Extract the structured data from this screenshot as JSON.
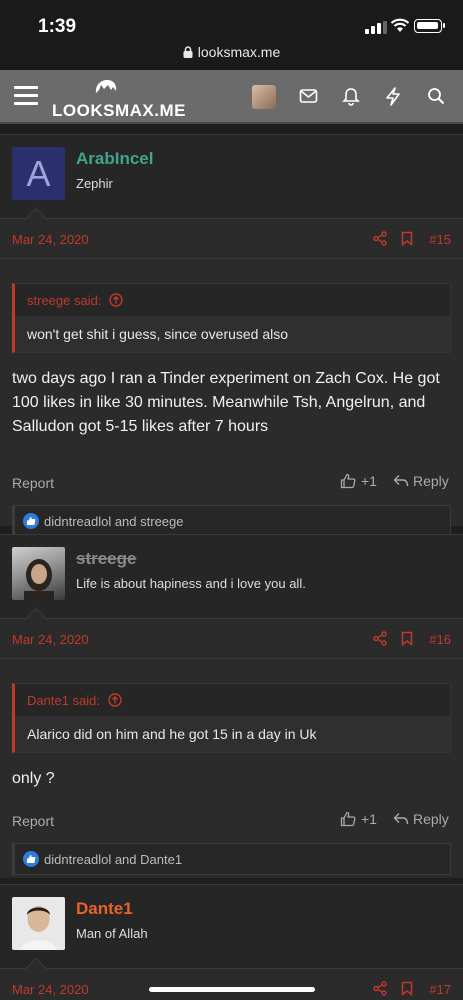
{
  "status": {
    "time": "1:39"
  },
  "browser": {
    "url": "looksmax.me"
  },
  "header": {
    "logo_text": "LOOKSMAX.ME"
  },
  "posts": [
    {
      "username": "ArabIncel",
      "username_color": "#3fa58c",
      "user_title": "Zephir",
      "avatar_letter": "A",
      "date": "Mar 24, 2020",
      "number": "#15",
      "quote_author": "streege said:",
      "quote_text": "won't get shit i guess, since overused also",
      "text": "two days ago I ran a Tinder experiment on Zach Cox. He got 100 likes in like 30 minutes. Meanwhile Tsh, Angelrun, and Salludon got 5-15 likes after 7 hours",
      "report_label": "Report",
      "like_label": "+1",
      "reply_label": "Reply",
      "reactions": "didntreadlol and streege"
    },
    {
      "username": "streege",
      "username_color": "#8a8a8a",
      "user_title": "Life is about hapiness and i love you all.",
      "date": "Mar 24, 2020",
      "number": "#16",
      "quote_author": "Dante1 said:",
      "quote_text": "Alarico did on him and he got 15 in a day in Uk",
      "text": "only ?",
      "report_label": "Report",
      "like_label": "+1",
      "reply_label": "Reply",
      "reactions": "didntreadlol and Dante1"
    },
    {
      "username": "Dante1",
      "username_color": "#e8622c",
      "user_title": "Man of Allah",
      "date": "Mar 24, 2020",
      "number": "#17"
    }
  ]
}
